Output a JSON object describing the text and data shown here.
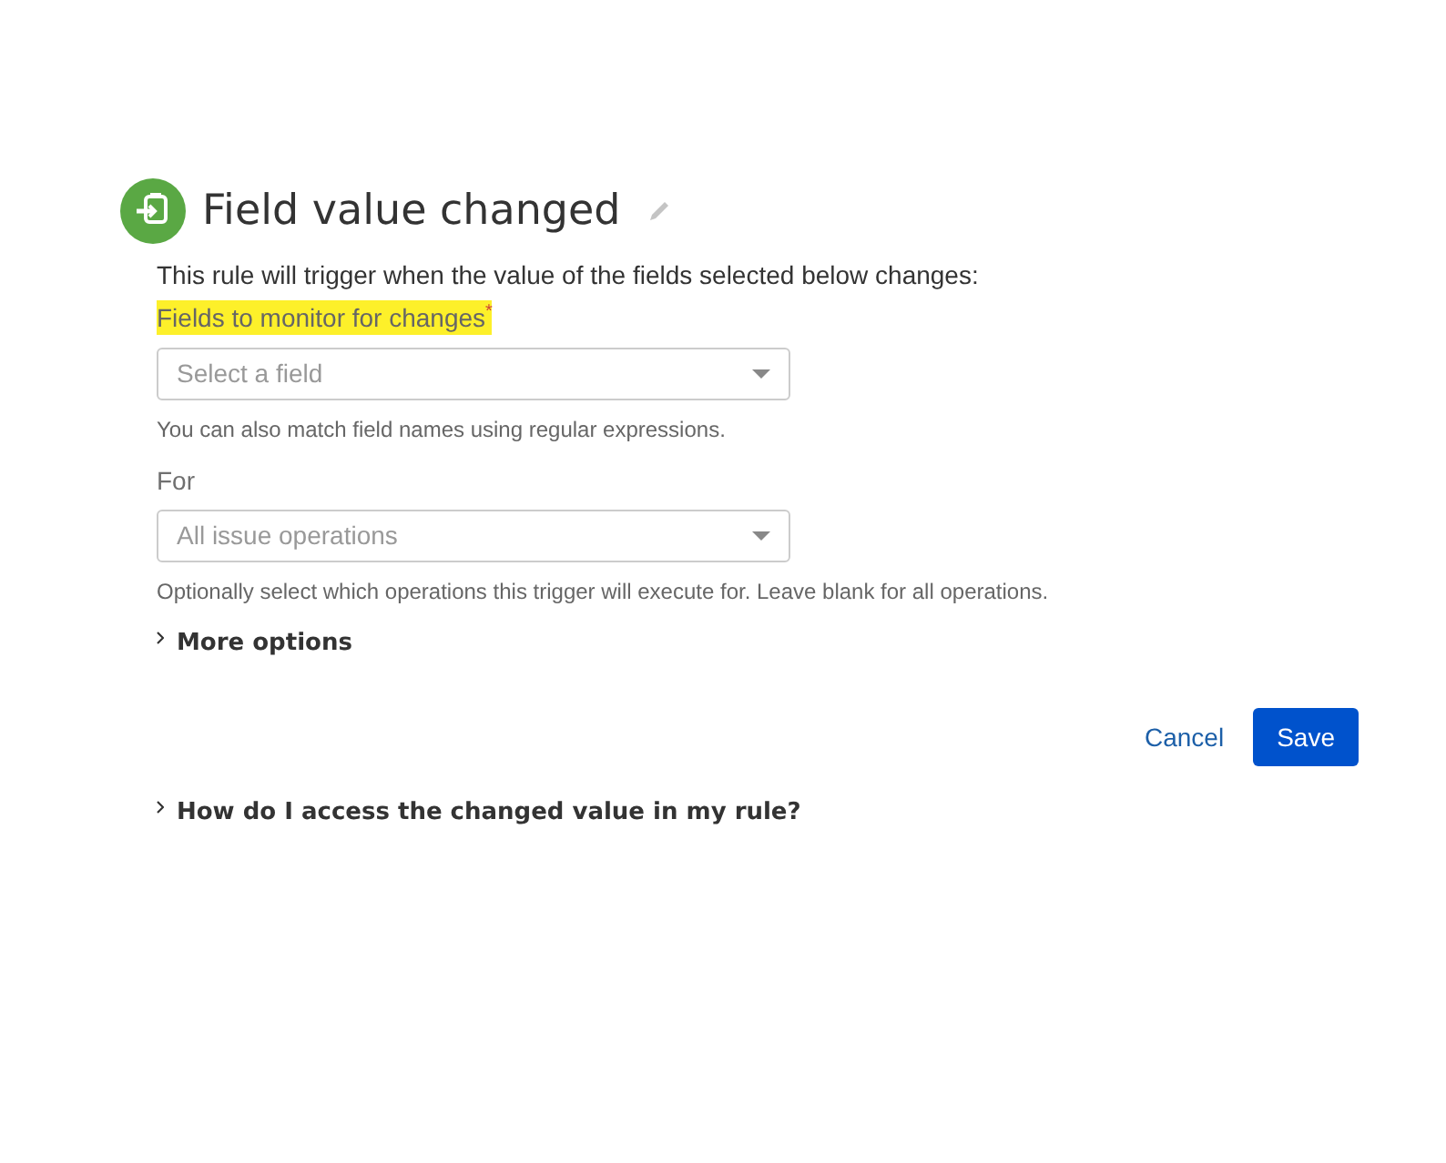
{
  "header": {
    "title": "Field value changed"
  },
  "description": "This rule will trigger when the value of the fields selected below changes:",
  "fields": [
    {
      "label": "Fields to monitor for changes",
      "required_mark": "*",
      "highlighted": true,
      "placeholder": "Select a field",
      "help": "You can also match field names using regular expressions."
    },
    {
      "label": "For",
      "highlighted": false,
      "placeholder": "All issue operations",
      "help": "Optionally select which operations this trigger will execute for. Leave blank for all operations."
    }
  ],
  "more_options": {
    "label": "More options",
    "expanded": false
  },
  "buttons": [
    {
      "label": "Cancel",
      "kind": "link"
    },
    {
      "label": "Save",
      "kind": "primary"
    }
  ],
  "help_toggle": {
    "label": "How do I access the changed value in my rule?",
    "expanded": false
  }
}
